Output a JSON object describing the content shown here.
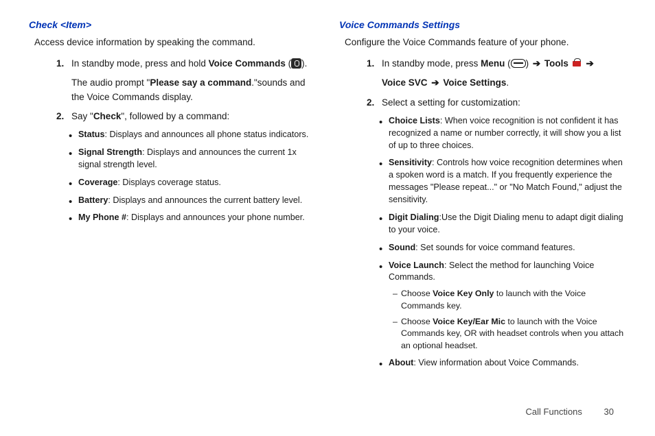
{
  "left": {
    "heading": "Check <Item>",
    "intro": "Access device information by speaking the command.",
    "step1_a": "In standby mode, press and hold ",
    "step1_b": "Voice Commands",
    "step1_c": " (",
    "step1_d": ").",
    "step1_line2_a": "The audio prompt \"",
    "step1_line2_b": "Please say a command",
    "step1_line2_c": ".\"sounds and the Voice Commands display.",
    "step2_a": "Say \"",
    "step2_b": "Check",
    "step2_c": "\", followed by a command:",
    "bullets": [
      {
        "b": "Status",
        "t": ": Displays and announces all phone status indicators."
      },
      {
        "b": "Signal Strength",
        "t": ": Displays and announces the current 1x signal strength level."
      },
      {
        "b": "Coverage",
        "t": ": Displays coverage status."
      },
      {
        "b": "Battery",
        "t": ": Displays and announces the current battery level."
      },
      {
        "b": "My Phone #",
        "t": ": Displays and announces your phone number."
      }
    ]
  },
  "right": {
    "heading": "Voice Commands Settings",
    "intro": "Configure the Voice Commands feature of your phone.",
    "step1_a": "In standby mode, press ",
    "step1_b": "Menu",
    "step1_tools": "Tools",
    "step1_line2_a": "Voice SVC",
    "step1_line2_b": "Voice Settings",
    "step2": "Select a setting for customization:",
    "bullets": [
      {
        "b": "Choice Lists",
        "t": ": When voice recognition is not confident  it has recognized a name or number correctly, it will show you a list of up to three choices."
      },
      {
        "b": "Sensitivity",
        "t": ": Controls how voice recognition determines when a spoken word is a match. If you frequently  experience the messages \"Please repeat...\" or \"No Match Found,\" adjust the sensitivity."
      },
      {
        "b": "Digit Dialing",
        "t": ":Use the Digit Dialing menu to adapt digit dialing to your voice."
      },
      {
        "b": "Sound",
        "t": ": Set sounds for voice command features."
      },
      {
        "b": "Voice Launch",
        "t": ": Select the method for launching Voice Commands."
      },
      {
        "b": "About",
        "t": ": View information about Voice Commands."
      }
    ],
    "launch_sub": [
      {
        "a": "Choose ",
        "b": "Voice Key Only",
        "c": " to launch with the Voice Commands key."
      },
      {
        "a": "Choose ",
        "b": "Voice Key/Ear Mic",
        "c": " to launch with the Voice Commands key, OR with headset controls when you attach an optional headset."
      }
    ]
  },
  "footer": {
    "section": "Call Functions",
    "page": "30"
  },
  "arrow": "➔"
}
